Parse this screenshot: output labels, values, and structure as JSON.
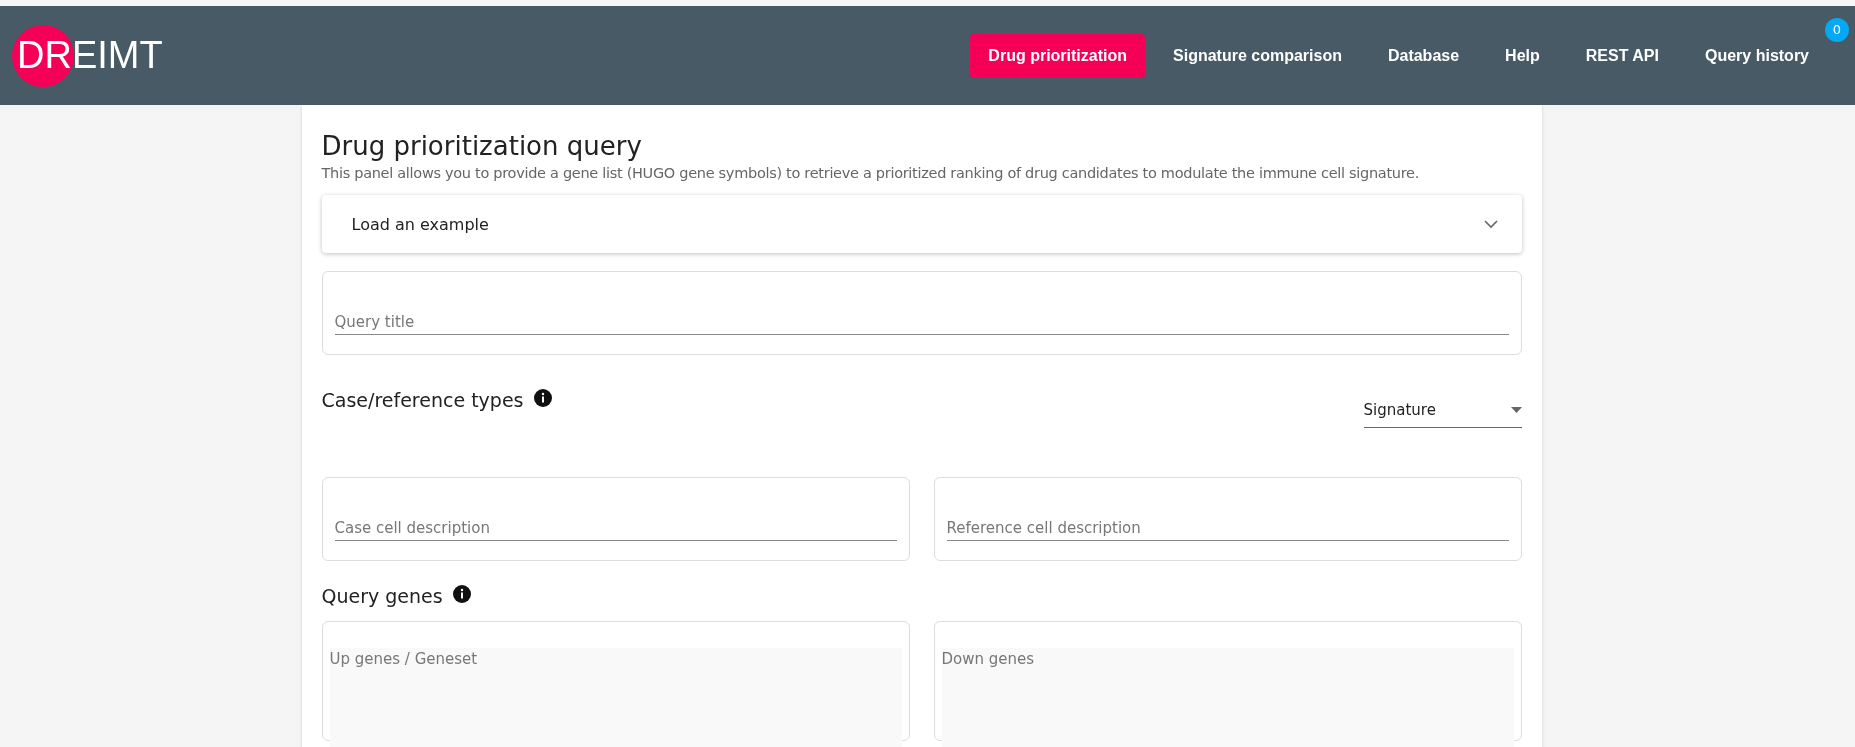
{
  "header": {
    "logo": {
      "highlight": "DR",
      "rest": "EIMT"
    },
    "nav": [
      {
        "label": "Drug prioritization",
        "selected": true
      },
      {
        "label": "Signature comparison",
        "selected": false
      },
      {
        "label": "Database",
        "selected": false
      },
      {
        "label": "Help",
        "selected": false
      },
      {
        "label": "REST API",
        "selected": false
      },
      {
        "label": "Query history",
        "selected": false,
        "badge": "0"
      }
    ]
  },
  "panel": {
    "title": "Drug prioritization query",
    "description": "This panel allows you to provide a gene list (HUGO gene symbols) to retrieve a prioritized ranking of drug candidates to modulate the immune cell signature.",
    "example": {
      "label": "Load an example",
      "expanded": false
    },
    "query_title": {
      "placeholder": "Query title"
    },
    "case_reference": {
      "heading": "Case/reference types",
      "select": "Signature",
      "fields": [
        {
          "placeholder": "Case cell description"
        },
        {
          "placeholder": "Reference cell description"
        }
      ]
    },
    "query_genes": {
      "heading": "Query genes",
      "fields": [
        {
          "placeholder": "Up genes / Geneset"
        },
        {
          "placeholder": "Down genes"
        }
      ]
    }
  }
}
